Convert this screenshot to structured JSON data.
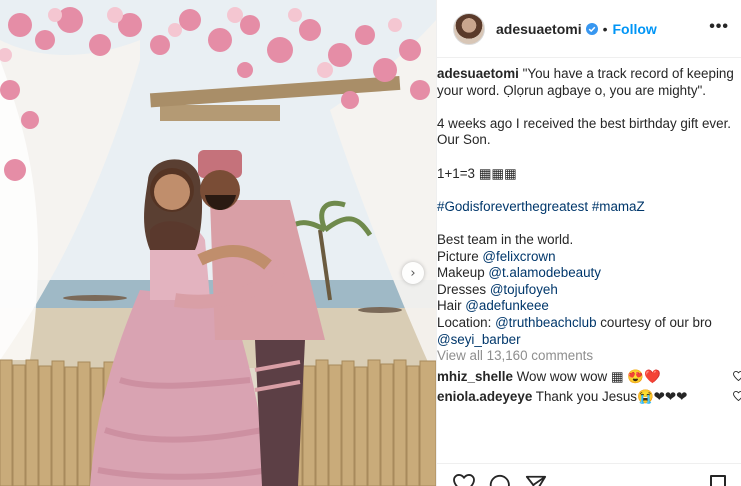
{
  "post": {
    "username": "adesuaetomi",
    "follow_label": "Follow",
    "separator": "•",
    "more_label": "•••",
    "carousel_next": "›"
  },
  "caption": {
    "username": "adesuaetomi",
    "line1": "\"You have a track record of keeping your word. Ọlọrun agbaye o, you are mighty\".",
    "line2": "4 weeks ago I received the best birthday gift ever. Our Son.",
    "line3": "1+1=3 ▦▦▦",
    "hashtag1": "#Godisforeverthegreatest",
    "hashtag2": "#mamaZ",
    "line4": "Best team in the world.",
    "credits": [
      {
        "label": "Picture ",
        "handle": "@felixcrown",
        "suffix": ""
      },
      {
        "label": "Makeup ",
        "handle": "@t.alamodebeauty",
        "suffix": ""
      },
      {
        "label": "Dresses ",
        "handle": "@tojufoyeh",
        "suffix": ""
      },
      {
        "label": "Hair ",
        "handle": "@adefunkeee",
        "suffix": ""
      },
      {
        "label": "Location: ",
        "handle": "@truthbeachclub",
        "suffix": " courtesy of our bro"
      }
    ],
    "last_handle": "@seyi_barber"
  },
  "comments": {
    "view_all": "View all 13,160 comments",
    "items": [
      {
        "username": "mhiz_shelle",
        "text": "Wow wow wow ▦ 😍❤️"
      },
      {
        "username": "eniola.adeyeye",
        "text": "Thank you Jesus😭❤❤❤"
      }
    ]
  },
  "icons": [
    "verified-badge-icon",
    "more-options-icon",
    "heart-icon",
    "comment-icon",
    "share-icon",
    "bookmark-icon",
    "chevron-right-icon"
  ],
  "colors": {
    "link": "#00376b",
    "follow": "#0095f6",
    "muted": "#8e8e8e",
    "text": "#262626"
  }
}
